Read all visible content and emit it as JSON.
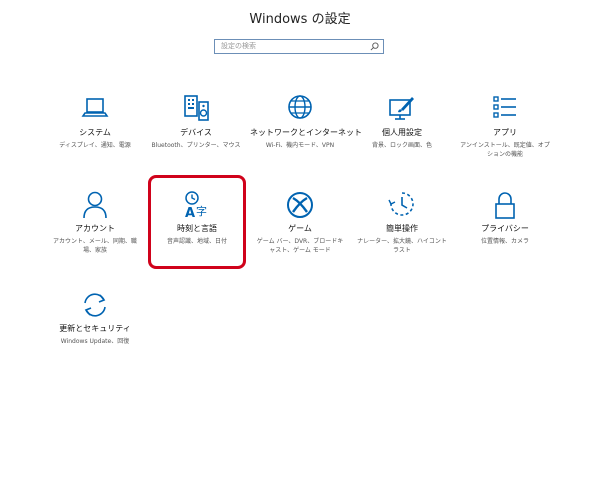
{
  "window": {
    "title": "Windows の設定"
  },
  "search": {
    "placeholder": "設定の検索"
  },
  "tiles": [
    {
      "label": "システム",
      "desc": "ディスプレイ、通知、電源",
      "icon": "laptop-icon"
    },
    {
      "label": "デバイス",
      "desc": "Bluetooth、プリンター、マウス",
      "icon": "keyboard-speaker-icon"
    },
    {
      "label": "ネットワークとインターネット",
      "desc": "Wi-Fi、機内モード、VPN",
      "icon": "globe-icon"
    },
    {
      "label": "個人用設定",
      "desc": "背景、ロック画面、色",
      "icon": "paint-monitor-icon"
    },
    {
      "label": "アプリ",
      "desc": "アンインストール、既定値、オプションの機能",
      "icon": "app-list-icon"
    },
    {
      "label": "アカウント",
      "desc": "アカウント、メール、同期、職場、家族",
      "icon": "person-icon"
    },
    {
      "label": "時刻と言語",
      "desc": "音声認識、地域、日付",
      "icon": "clock-language-icon"
    },
    {
      "label": "ゲーム",
      "desc": "ゲーム バー、DVR、ブロードキャスト、ゲーム モード",
      "icon": "xbox-icon"
    },
    {
      "label": "簡単操作",
      "desc": "ナレーター、拡大鏡、ハイコントラスト",
      "icon": "ease-of-access-icon"
    },
    {
      "label": "プライバシー",
      "desc": "位置情報、カメラ",
      "icon": "lock-icon"
    },
    {
      "label": "更新とセキュリティ",
      "desc": "Windows Update、回復",
      "icon": "refresh-icon"
    }
  ],
  "colors": {
    "accent": "#0063b1",
    "highlight": "#d0021b",
    "search_border": "#6c8fb7"
  }
}
